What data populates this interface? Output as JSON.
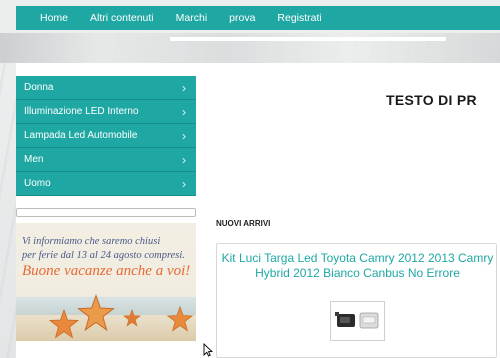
{
  "nav": {
    "items": [
      "Home",
      "Altri contenuti",
      "Marchi",
      "prova",
      "Registrati"
    ]
  },
  "sidebar": {
    "items": [
      {
        "label": "Donna"
      },
      {
        "label": "Illuminazione LED Interno"
      },
      {
        "label": "Lampada Led Automobile"
      },
      {
        "label": "Men"
      },
      {
        "label": "Uomo"
      }
    ],
    "chevron": "›"
  },
  "banner": {
    "line1": "Vi informiamo che saremo chiusi",
    "line2": "per ferie dal 13 al 24 agosto compresi.",
    "line3": "Buone vacanze anche a voi!"
  },
  "main": {
    "heading": "TESTO DI PR",
    "section_title": "NUOVI ARRIVI",
    "product": {
      "title": "Kit Luci Targa Led Toyota Camry 2012 2013 Camry Hybrid 2012 Bianco Canbus No Errore"
    }
  },
  "colors": {
    "accent": "#1fa8a3",
    "banner_text": "#4a5a8a",
    "banner_highlight": "#e56a34"
  }
}
